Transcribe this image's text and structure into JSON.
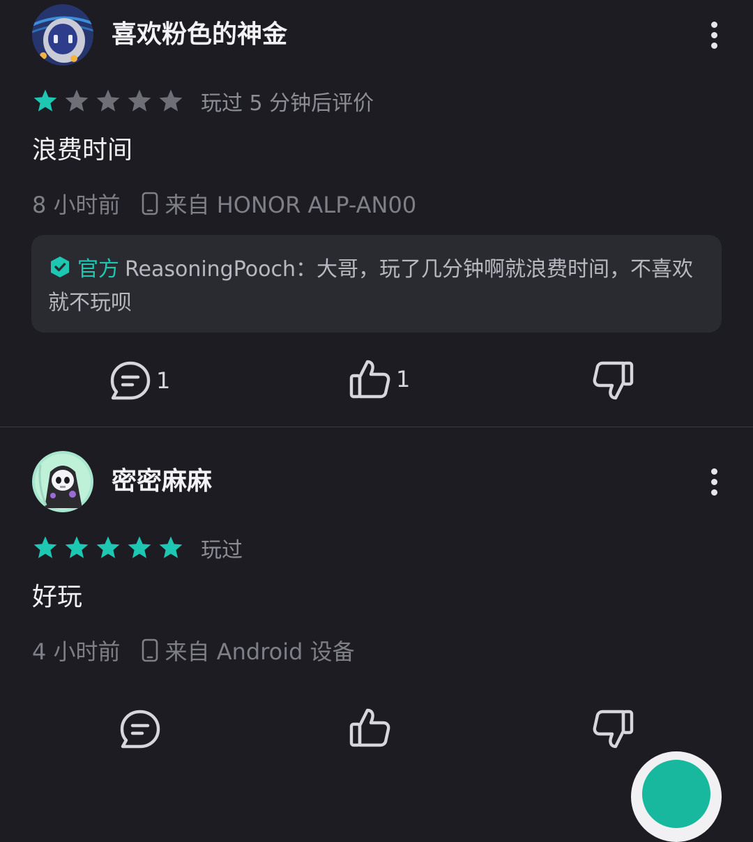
{
  "colors": {
    "background": "#1c1c22",
    "accent": "#1ec7b2",
    "star_off": "#6f6f77",
    "muted_text": "#7f7f87",
    "reply_bg": "#2a2a31"
  },
  "icons": {
    "more": "more-vertical-icon",
    "star": "star-icon",
    "device": "phone-icon",
    "official": "shield-check-icon",
    "comment": "comment-icon",
    "like": "thumbs-up-icon",
    "dislike": "thumbs-down-icon"
  },
  "reviews": [
    {
      "username": "喜欢粉色的神金",
      "rating": 1,
      "rating_max": 5,
      "play_note": "玩过 5 分钟后评价",
      "content": "浪费时间",
      "time": "8 小时前",
      "device": "来自 HONOR ALP-AN00",
      "reply": {
        "label": "官方",
        "author": "ReasoningPooch",
        "separator": "：",
        "text": "大哥，玩了几分钟啊就浪费时间，不喜欢就不玩呗"
      },
      "comment_count": "1",
      "like_count": "1"
    },
    {
      "username": "密密麻麻",
      "rating": 5,
      "rating_max": 5,
      "play_note": "玩过",
      "content": "好玩",
      "time": "4 小时前",
      "device": "来自 Android 设备"
    }
  ]
}
